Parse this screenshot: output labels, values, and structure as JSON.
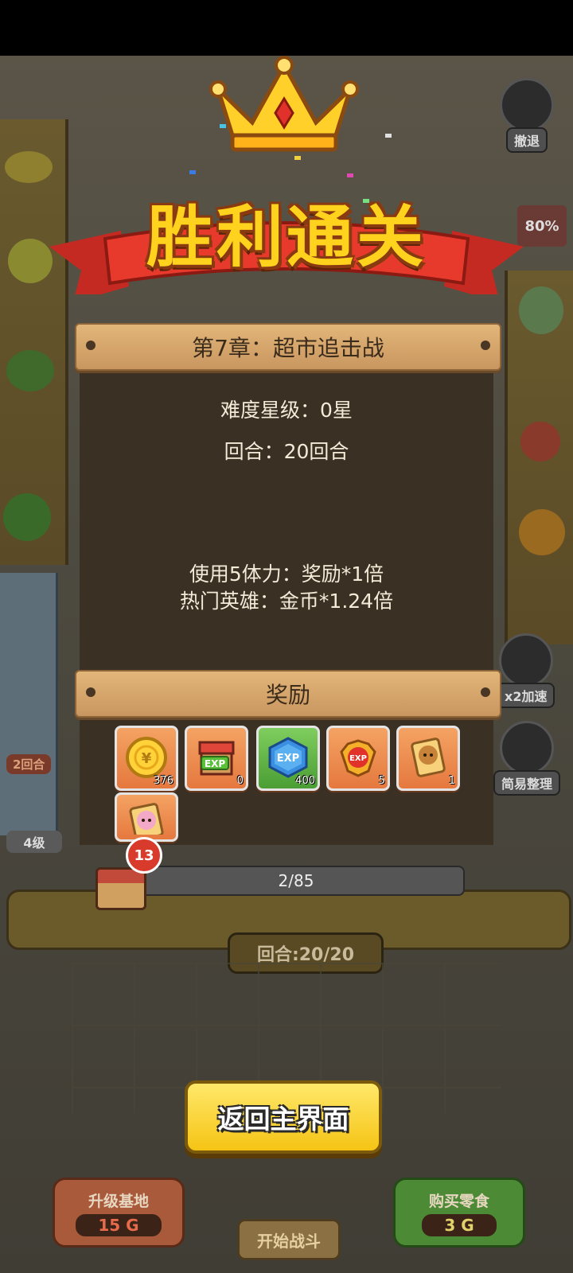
{
  "victory": {
    "title": "胜利通关",
    "chapter_title": "第7章：超市追击战",
    "difficulty": "难度星级：0星",
    "rounds": "回合：20回合",
    "bonus_stamina": "使用5体力：奖励*1倍",
    "bonus_hero": "热门英雄：金币*1.24倍",
    "rewards_header": "奖励",
    "rewards": [
      {
        "name": "gold-coin",
        "count": "376",
        "style": "orange"
      },
      {
        "name": "shop-exp",
        "count": "0",
        "style": "orange"
      },
      {
        "name": "blue-exp",
        "count": "400",
        "style": "green"
      },
      {
        "name": "badge-exp",
        "count": "5",
        "style": "orange"
      },
      {
        "name": "hero-card",
        "count": "1",
        "style": "orange"
      },
      {
        "name": "pink-hero-card",
        "count": "",
        "style": "orange"
      }
    ],
    "progress": {
      "badge": "13",
      "text": "2/85",
      "fraction": 0.0235
    },
    "return_button": "返回主界面"
  },
  "background": {
    "retreat_label": "撤退",
    "round_counter": "回合:20/20",
    "left_round_tag": "2回合",
    "left_level_tag": "4级",
    "speed_label": "x2加速",
    "sort_label": "简易整理",
    "upgrade_label": "升级基地",
    "upgrade_price": "15 G",
    "buy_label": "购买零食",
    "buy_price": "3 G",
    "battle_label": "开始战斗",
    "sale_tag": "80%"
  },
  "colors": {
    "title": "#ffd21e",
    "panel": "#3a3024",
    "plank": "#d8a86d",
    "return_button": "#f5c414"
  }
}
